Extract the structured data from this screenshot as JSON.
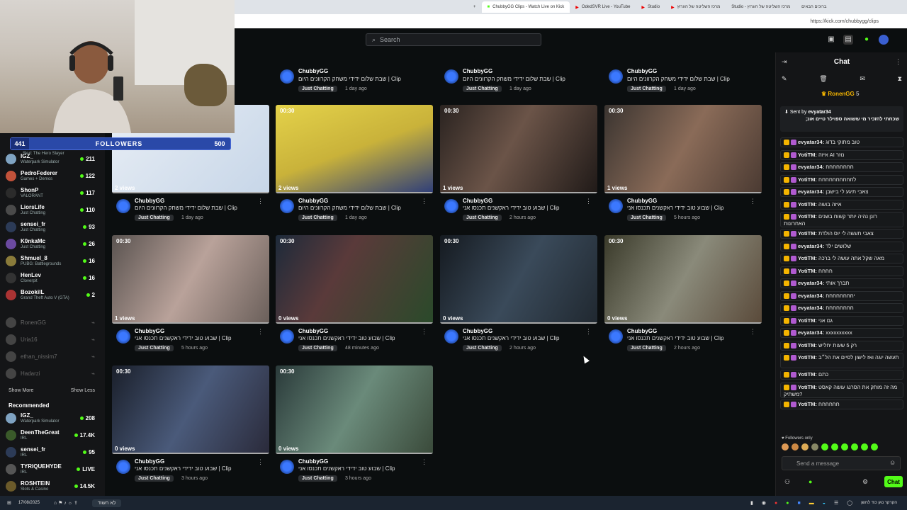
{
  "browser": {
    "tabs": [
      {
        "label": "ChubbyGG Clips - Watch Live on Kick",
        "active": true
      },
      {
        "label": "OdedSVR Live - YouTube"
      },
      {
        "label": "Studio"
      },
      {
        "label": "מרכז השליטה של הערוץ"
      },
      {
        "label": "Studio - מרכז השליטה של הערוץ"
      },
      {
        "label": "ברוכים הבאים"
      }
    ],
    "url": "https://kick.com/chubbygg/clips"
  },
  "header": {
    "search_placeholder": "Search"
  },
  "overlay": {
    "followers_count": "441",
    "followers_label": "FOLLOWERS",
    "followers_goal": "500"
  },
  "sidebar": {
    "following": [
      {
        "name": "Skul: The Hero Slayer",
        "game": "",
        "count": "",
        "partial": true
      },
      {
        "name": "IGZ_",
        "game": "Waterpark Simulator",
        "count": "211",
        "color": "#7fa3c2"
      },
      {
        "name": "PedroFederer",
        "game": "Games + Demos",
        "count": "122",
        "color": "#c2523a"
      },
      {
        "name": "ShonP",
        "game": "VALORANT",
        "count": "117",
        "color": "#2b2b2b"
      },
      {
        "name": "LiorsLife",
        "game": "Just Chatting",
        "count": "110",
        "color": "#4a4a4a"
      },
      {
        "name": "sensei_fr",
        "game": "Just Chatting",
        "count": "93",
        "color": "#2c3b57"
      },
      {
        "name": "K0nkaMc",
        "game": "Just Chatting",
        "count": "26",
        "color": "#6b4aa0"
      },
      {
        "name": "Shmuel_8",
        "game": "PUBG: Battlegrounds",
        "count": "16",
        "color": "#8a7b3a"
      },
      {
        "name": "HenLev",
        "game": "Cloverpit",
        "count": "16",
        "color": "#333"
      },
      {
        "name": "BozokilL",
        "game": "Grand Theft Auto V (GTA)",
        "count": "2",
        "color": "#a33"
      }
    ],
    "offline": [
      "RonenGG",
      "Uria16",
      "ethan_nissim7",
      "Hadarzi"
    ],
    "show_more": "Show More",
    "show_less": "Show Less",
    "recommended_label": "Recommended",
    "recommended": [
      {
        "name": "IGZ_",
        "game": "Waterpark Simulator",
        "count": "208",
        "color": "#7fa3c2"
      },
      {
        "name": "DeenTheGreat",
        "game": "IRL",
        "count": "17.4K",
        "color": "#3a5a2a"
      },
      {
        "name": "sensei_fr",
        "game": "IRL",
        "count": "95",
        "color": "#2c3b57"
      },
      {
        "name": "TYRIQUEHYDE",
        "game": "IRL",
        "count": "LIVE",
        "color": "#555"
      },
      {
        "name": "ROSHTEIN",
        "game": "Slots & Casino",
        "count": "14.5K",
        "color": "#6b5a2a"
      }
    ]
  },
  "clips_top_row": [
    {
      "channel": "ChubbyGG",
      "title": "שבת שלום ידידי משחק הקרוונים היום | Clip",
      "tag": "Just Chatting",
      "time": "1 day ago"
    },
    {
      "channel": "ChubbyGG",
      "title": "שבת שלום ידידי משחק הקרוונים היום | Clip",
      "tag": "Just Chatting",
      "time": "1 day ago"
    },
    {
      "channel": "ChubbyGG",
      "title": "שבת שלום ידידי משחק הקרוונים היום | Clip",
      "tag": "Just Chatting",
      "time": "1 day ago"
    }
  ],
  "clips": [
    {
      "duration": "00:30",
      "views": "2 views",
      "channel": "ChubbyGG",
      "title": "שבת שלום ידידי משחק הקרוונים היום | Clip",
      "tag": "Just Chatting",
      "time": "1 day ago",
      "bg": "linear-gradient(135deg,#e8eef5,#c7d6e8)"
    },
    {
      "duration": "00:30",
      "views": "2 views",
      "channel": "ChubbyGG",
      "title": "שבת שלום ידידי משחק הקרוונים היום | Clip",
      "tag": "Just Chatting",
      "time": "1 day ago",
      "bg": "linear-gradient(160deg,#e4d24a,#c9b23a 50%,#2d3d7a)"
    },
    {
      "duration": "00:30",
      "views": "1 views",
      "channel": "ChubbyGG",
      "title": "שבוע טוב ידידי ראקשנים תכנסו אני | Clip",
      "tag": "Just Chatting",
      "time": "2 hours ago",
      "bg": "linear-gradient(120deg,#2a2320,#6b5448 45%,#201a18)"
    },
    {
      "duration": "00:30",
      "views": "1 views",
      "channel": "ChubbyGG",
      "title": "שבוע טוב ידידי ראקשנים תכנסו אני | Clip",
      "tag": "Just Chatting",
      "time": "5 hours ago",
      "bg": "linear-gradient(120deg,#3a3430,#8a6b58 50%,#4a3a32)"
    },
    {
      "duration": "00:30",
      "views": "1 views",
      "channel": "ChubbyGG",
      "title": "שבוע טוב ידידי ראקשנים תכנסו אני | Clip",
      "tag": "Just Chatting",
      "time": "5 hours ago",
      "bg": "linear-gradient(120deg,#5a5350,#b9a29a 50%,#6a5f5a)"
    },
    {
      "duration": "00:30",
      "views": "0 views",
      "channel": "ChubbyGG",
      "title": "שבוע טוב ידידי ראקשנים תכנסו אני | Clip",
      "tag": "Just Chatting",
      "time": "48 minutes ago",
      "bg": "linear-gradient(120deg,#1d2a3a,#5a3a3a 40%,#2a4a2a)"
    },
    {
      "duration": "00:30",
      "views": "0 views",
      "channel": "ChubbyGG",
      "title": "שבוע טוב ידידי ראקשנים תכנסו אני | Clip",
      "tag": "Just Chatting",
      "time": "2 hours ago",
      "bg": "linear-gradient(120deg,#151a20,#3a4a5a 50%,#202830)"
    },
    {
      "duration": "00:30",
      "views": "0 views",
      "channel": "ChubbyGG",
      "title": "שבוע טוב ידידי ראקשנים תכנסו אני | Clip",
      "tag": "Just Chatting",
      "time": "2 hours ago",
      "bg": "linear-gradient(120deg,#3a3a2a,#8a8a7a 50%,#5a4a3a)"
    },
    {
      "duration": "00:30",
      "views": "0 views",
      "channel": "ChubbyGG",
      "title": "שבוע טוב ידידי ראקשנים תכנסו אני | Clip",
      "tag": "Just Chatting",
      "time": "3 hours ago",
      "bg": "linear-gradient(120deg,#1a1f2a,#4a5a7a 50%,#2a2a3a)"
    },
    {
      "duration": "00:30",
      "views": "0 views",
      "channel": "ChubbyGG",
      "title": "שבוע טוב ידידי ראקשנים תכנסו אני | Clip",
      "tag": "Just Chatting",
      "time": "3 hours ago",
      "bg": "linear-gradient(120deg,#2a3a3a,#6a8a7a 50%,#3a4a3a)"
    }
  ],
  "chat": {
    "title": "Chat",
    "top_user": "RonenGG",
    "top_user_count": "5",
    "pinned_sent_by": "Sent by",
    "pinned_user": "evyatar34",
    "pinned_text": "שכחתי להזכיר מי ששואה ספוילר טיים אונ;",
    "messages": [
      {
        "user": "evyatar34:",
        "text": "טוב מתוקי בדוג",
        "color": "#e9e9e9"
      },
      {
        "user": "YotiTM:",
        "text": "איזה AI נוזר",
        "color": "#e9e9e9"
      },
      {
        "user": "evyatar34:",
        "text": "חחחחחחחח",
        "color": "#e9e9e9"
      },
      {
        "user": "YotiTM:",
        "text": "לחחחחחחחחחח",
        "color": "#e9e9e9"
      },
      {
        "user": "evyatar34:",
        "text": "צאבי תיגע לי בישבן",
        "color": "#e9e9e9"
      },
      {
        "user": "YotiTM:",
        "text": "איזה בושה",
        "color": "#e9e9e9"
      },
      {
        "user": "YotiTM:",
        "text": "רונן נהיה יותר קשוח בשנים האחרונות",
        "color": "#e9e9e9"
      },
      {
        "user": "YotiTM:",
        "text": "צאבי תעשה לי יוס הולדת",
        "color": "#e9e9e9"
      },
      {
        "user": "evyatar34:",
        "text": "שלושים ילד",
        "color": "#e9e9e9"
      },
      {
        "user": "YotiTM:",
        "text": "מאה שקל אתה עושה לי ברכה",
        "color": "#e9e9e9"
      },
      {
        "user": "YotiTM:",
        "text": "חחחח",
        "color": "#e9e9e9"
      },
      {
        "user": "evyatar34:",
        "text": "תברך אותי",
        "color": "#e9e9e9"
      },
      {
        "user": "evyatar34:",
        "text": "יחחחחחחחח",
        "color": "#e9e9e9"
      },
      {
        "user": "evyatar34:",
        "text": "חחחחחחחח",
        "color": "#e9e9e9"
      },
      {
        "user": "YotiTM:",
        "text": "גם אני",
        "color": "#e9e9e9"
      },
      {
        "user": "evyatar34:",
        "text": "xxxxxxxxxx",
        "color": "#e9e9e9"
      },
      {
        "user": "YotiTM:",
        "text": "רק 5 שעות יחליש",
        "color": "#e9e9e9"
      },
      {
        "user": "YotiTM:",
        "text": "תעשה יוגה ואז לישון לסיים את הל״ב",
        "color": "#e9e9e9"
      },
      {
        "user": "YotiTM:",
        "text": "כתם",
        "color": "#e9e9e9"
      },
      {
        "user": "YotiTM:",
        "text": "מה זה מותק את הסרנג עושה קאסט משתיק?",
        "color": "#e9e9e9"
      },
      {
        "user": "YotiTM:",
        "text": "חחחחחח",
        "color": "#e9e9e9"
      }
    ],
    "followers_only": "Followers only",
    "input_placeholder": "Send a message",
    "send_label": "Chat"
  },
  "taskbar": {
    "search_text": "לא חשוד",
    "weather": "הקרקר נאן כוד לחשן",
    "time": "17/08/2025"
  }
}
